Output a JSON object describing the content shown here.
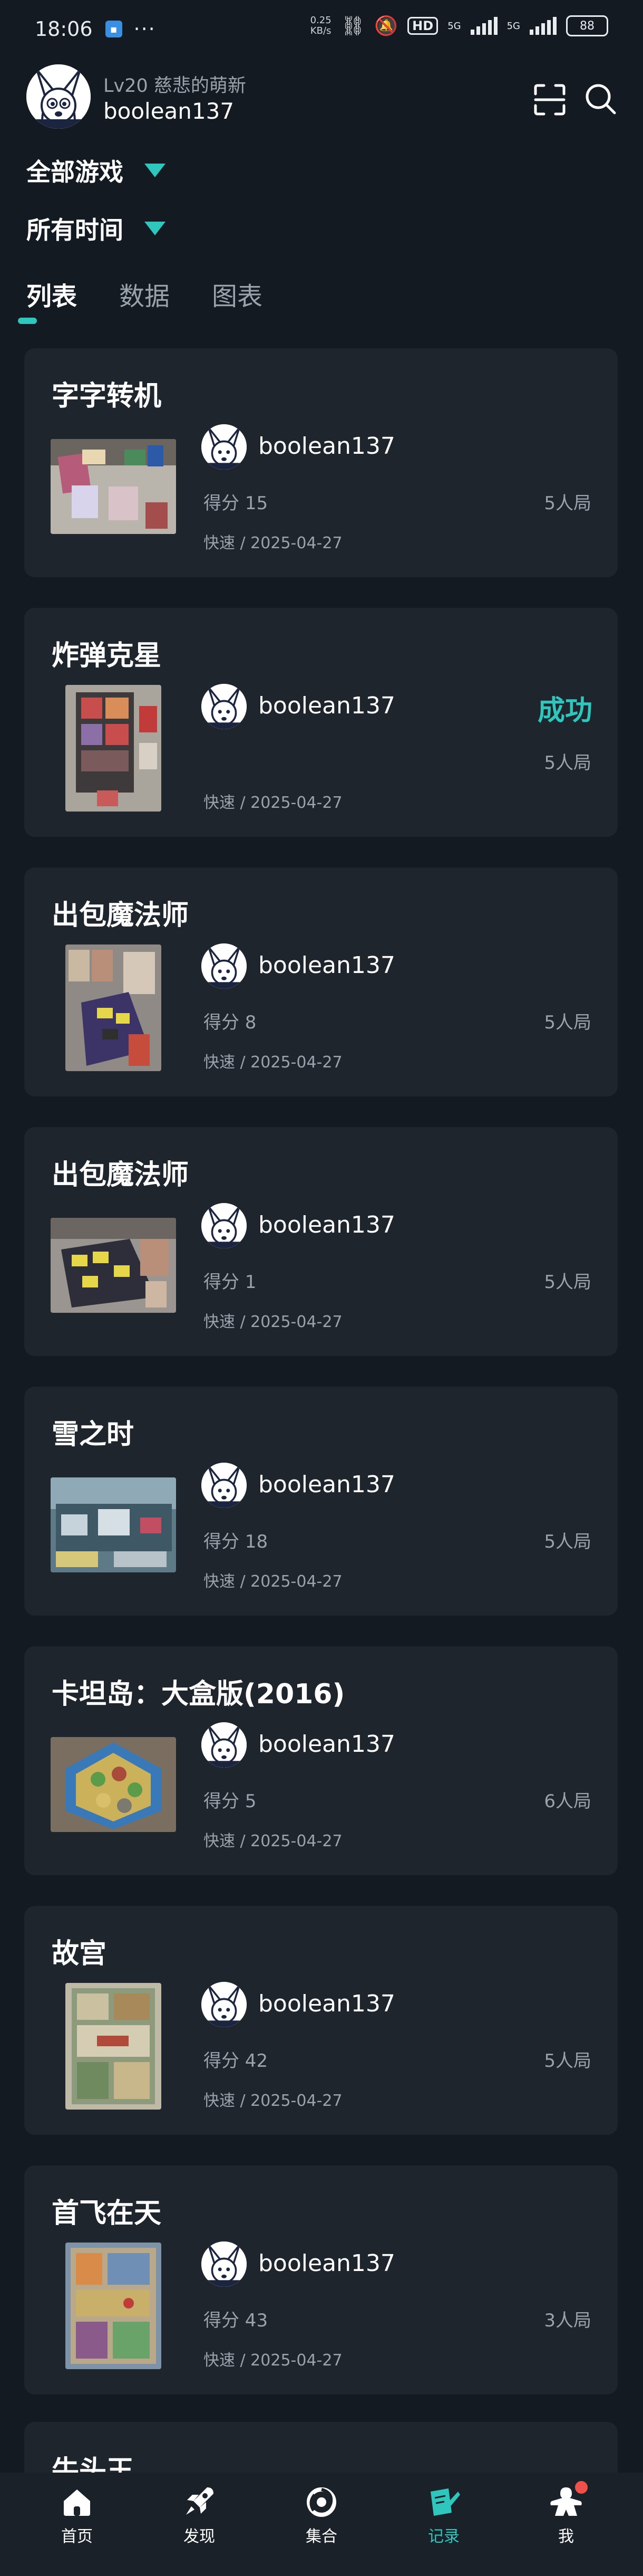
{
  "status_bar": {
    "time": "18:06",
    "dots": "···",
    "speed_value": "0.25",
    "speed_unit": "KB/s",
    "hd": "HD",
    "net1": "5G",
    "net2": "5G",
    "battery": "88"
  },
  "header": {
    "level": "Lv20 慈悲的萌新",
    "username": "boolean137"
  },
  "filters": {
    "game": "全部游戏",
    "time": "所有时间"
  },
  "tabs": [
    {
      "label": "列表",
      "active": true
    },
    {
      "label": "数据",
      "active": false
    },
    {
      "label": "图表",
      "active": false
    }
  ],
  "records": [
    {
      "title": "字字转机",
      "user": "boolean137",
      "score": "得分 15",
      "result": "",
      "players": "5人局",
      "meta": "快速 / 2025-04-27"
    },
    {
      "title": "炸弹克星",
      "user": "boolean137",
      "score": "",
      "result": "成功",
      "players": "5人局",
      "meta": "快速 / 2025-04-27"
    },
    {
      "title": "出包魔法师",
      "user": "boolean137",
      "score": "得分 8",
      "result": "",
      "players": "5人局",
      "meta": "快速 / 2025-04-27"
    },
    {
      "title": "出包魔法师",
      "user": "boolean137",
      "score": "得分 1",
      "result": "",
      "players": "5人局",
      "meta": "快速 / 2025-04-27"
    },
    {
      "title": "雪之时",
      "user": "boolean137",
      "score": "得分 18",
      "result": "",
      "players": "5人局",
      "meta": "快速 / 2025-04-27"
    },
    {
      "title": "卡坦岛：大盒版(2016)",
      "user": "boolean137",
      "score": "得分 5",
      "result": "",
      "players": "6人局",
      "meta": "快速 / 2025-04-27"
    },
    {
      "title": "故宫",
      "user": "boolean137",
      "score": "得分 42",
      "result": "",
      "players": "5人局",
      "meta": "快速 / 2025-04-27"
    },
    {
      "title": "首飞在天",
      "user": "boolean137",
      "score": "得分 43",
      "result": "",
      "players": "3人局",
      "meta": "快速 / 2025-04-27"
    }
  ],
  "peek_title": "牛头王",
  "bottom_nav": [
    {
      "label": "首页",
      "icon": "home-icon",
      "active": false
    },
    {
      "label": "发现",
      "icon": "rocket-icon",
      "active": false
    },
    {
      "label": "集合",
      "icon": "swirl-icon",
      "active": false
    },
    {
      "label": "记录",
      "icon": "edit-note-icon",
      "active": true
    },
    {
      "label": "我",
      "icon": "meeple-icon",
      "active": false,
      "badge": true
    }
  ],
  "colors": {
    "background": "#141a21",
    "card": "#1e252d",
    "accent": "#2fc7bd",
    "muted_text": "#9aa3ab",
    "badge_red": "#f0504a"
  }
}
